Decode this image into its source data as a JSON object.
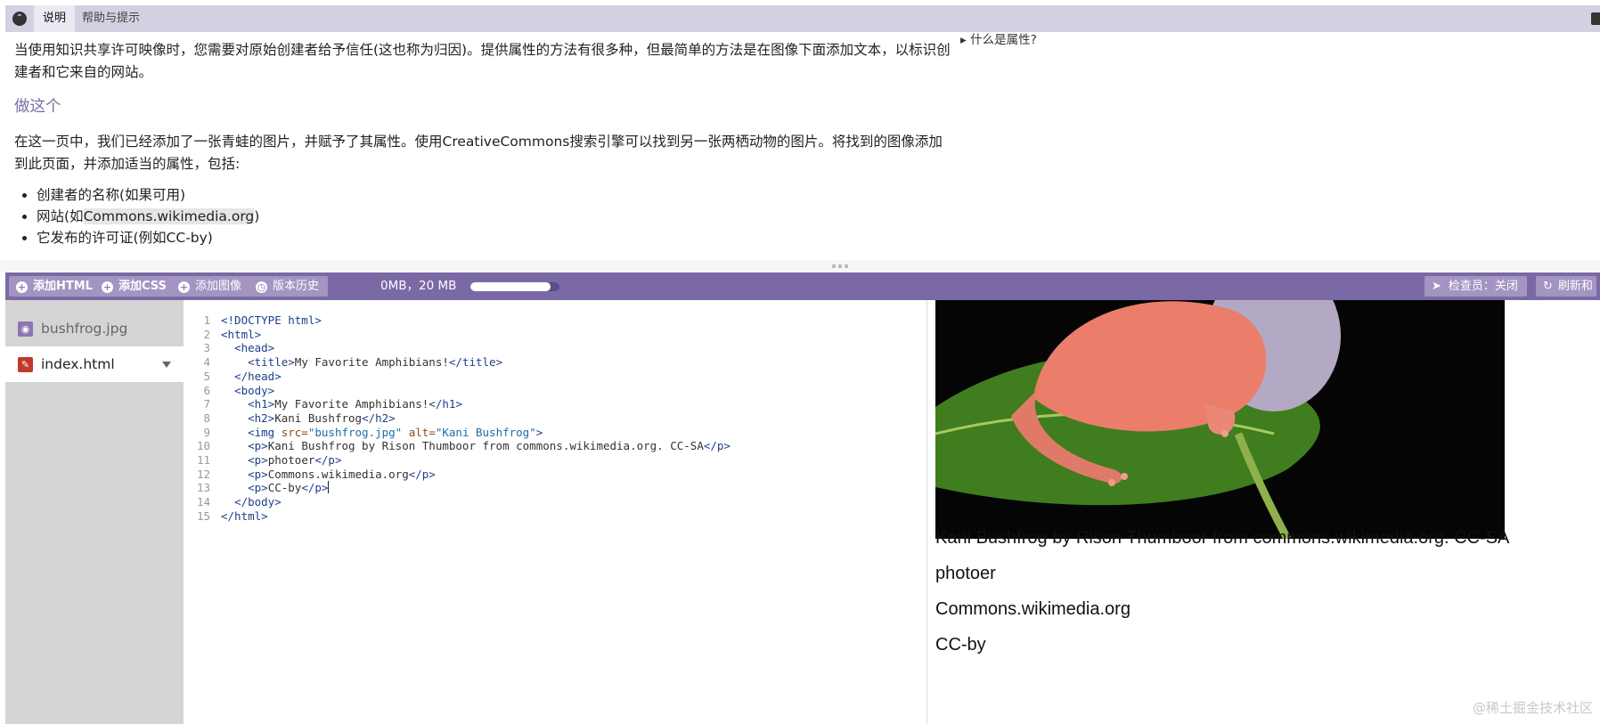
{
  "tabs": {
    "active": "说明",
    "other": "帮助与提示"
  },
  "instructions": {
    "intro": "当使用知识共享许可映像时，您需要对原始创建者给予信任(这也称为归因)。提供属性的方法有很多种，但最简单的方法是在图像下面添加文本，以标识创建者和它来自的网站。",
    "heading": "做这个",
    "body": "在这一页中，我们已经添加了一张青蛙的图片，并赋予了其属性。使用CreativeCommons搜索引擎可以找到另一张两栖动物的图片。将找到的图像添加到此页面，并添加适当的属性，包括:",
    "items": [
      "创建者的名称(如果可用)",
      "网站(如",
      "Commons.wikimedia.org",
      ")",
      "它发布的许可证(例如CC-by)"
    ],
    "details": "什么是属性?"
  },
  "toolbar": {
    "add_html": "添加HTML",
    "add_css": "添加CSS",
    "add_image": "添加图像",
    "history": "版本历史",
    "storage": "0MB，20 MB",
    "storage_fraction": 0.0,
    "inspector": "检查员：关闭",
    "refresh": "刷新和"
  },
  "files": [
    {
      "name": "bushfrog.jpg"
    },
    {
      "name": "index.html"
    }
  ],
  "code": {
    "line_numbers": [
      "1",
      "2",
      "3",
      "4",
      "5",
      "6",
      "7",
      "8",
      "9",
      "10",
      "11",
      "12",
      "13",
      "14",
      "15"
    ],
    "lines": [
      [
        "<!DOCTYPE html>"
      ],
      [
        "<html>"
      ],
      [
        "  <head>"
      ],
      [
        "    <title>",
        "My Favorite Amphibians!",
        "</title>"
      ],
      [
        "  </head>"
      ],
      [
        "  <body>"
      ],
      [
        "    <h1>",
        "My Favorite Amphibians!",
        "</h1>"
      ],
      [
        "    <h2>",
        "Kani Bushfrog",
        "</h2>"
      ],
      [
        "    <img ",
        "src=",
        "\"bushfrog.jpg\"",
        " alt=",
        "\"Kani Bushfrog\"",
        ">"
      ],
      [
        "    <p>",
        "Kani Bushfrog by Rison Thumboor from commons.wikimedia.org. CC-SA",
        "</p>"
      ],
      [
        "    <p>",
        "photoer",
        "</p>"
      ],
      [
        "    <p>",
        "Commons.wikimedia.org",
        "</p>"
      ],
      [
        "    <p>",
        "CC-by",
        "</p>"
      ],
      [
        "  </body>"
      ],
      [
        "</html>"
      ]
    ]
  },
  "preview": {
    "p1": "Kani Bushfrog by Rison Thumboor from commons.wikimedia.org. CC-SA",
    "p2": "photoer",
    "p3": "Commons.wikimedia.org",
    "p4": "CC-by"
  },
  "watermark": "@稀土掘金技术社区",
  "colors": {
    "toolbar": "#7b69a5",
    "button": "#a394c2",
    "tabstrip": "#d4cfe1",
    "file_panel": "#d4d4d4"
  }
}
